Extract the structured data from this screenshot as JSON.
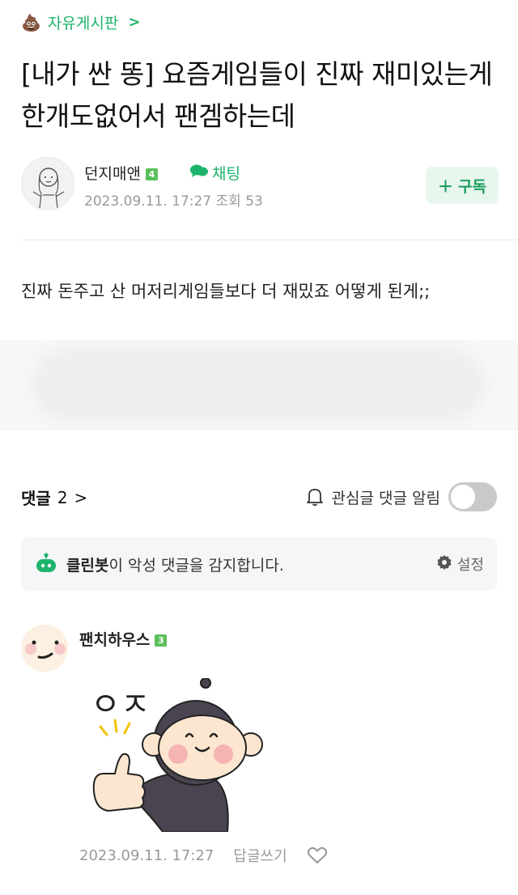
{
  "board": {
    "label": "자유게시판",
    "chevron": ">"
  },
  "post": {
    "title": "[내가 싼 똥] 요즘게임들이 진짜 재미있는게 한개도없어서 팬겜하는데",
    "author": "던지매앤",
    "author_level": "4",
    "chat_label": "채팅",
    "date": "2023.09.11. 17:27",
    "views_label": "조회 53",
    "subscribe_label": "구독",
    "body": "진짜 돈주고 산 머저리게임들보다 더 재밌죠 어떻게 된게;;"
  },
  "comments_section": {
    "label": "댓글",
    "count": "2",
    "notify_label": "관심글 댓글 알림",
    "notify_on": false
  },
  "cleanbot": {
    "name": "클린봇",
    "message": "이 악성 댓글을 감지합니다.",
    "settings_label": "설정"
  },
  "comments": [
    {
      "author": "팬치하우스",
      "level": "3",
      "sticker_text": "ㅇㅈ",
      "date": "2023.09.11. 17:27",
      "reply_label": "답글쓰기"
    }
  ],
  "colors": {
    "accent": "#1db36b",
    "muted": "#999999"
  },
  "icons": [
    "poop-icon",
    "chat-icon",
    "plus-icon",
    "chevron-right-icon",
    "bell-icon",
    "robot-icon",
    "gear-icon",
    "heart-icon"
  ]
}
